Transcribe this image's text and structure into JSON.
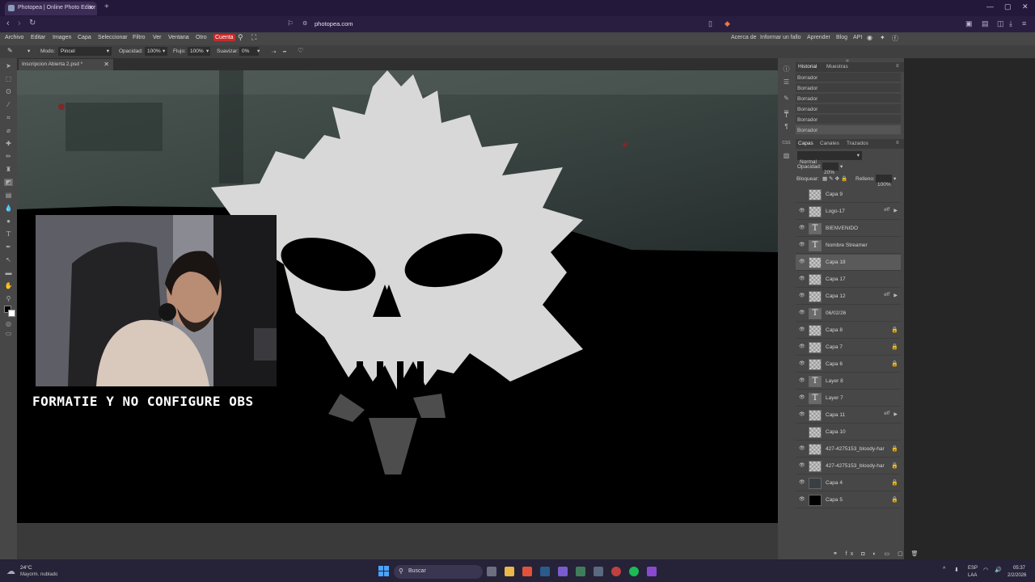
{
  "browser": {
    "tab_title": "Photopea | Online Photo Editor",
    "url": "photopea.com"
  },
  "menu": {
    "items": [
      "Archivo",
      "Editar",
      "Imagen",
      "Capa",
      "Seleccionar",
      "Filtro",
      "Ver",
      "Ventana",
      "Otro"
    ],
    "account": "Cuenta",
    "right_items": [
      "Acerca de",
      "Informar un fallo",
      "Aprender",
      "Blog",
      "API"
    ]
  },
  "options": {
    "mode_label": "Modo:",
    "mode_value": "Pincel",
    "opacity_label": "Opacidad:",
    "opacity_value": "100%",
    "flow_label": "Flujo:",
    "flow_value": "100%",
    "smooth_label": "Suavizar:",
    "smooth_value": "0%"
  },
  "document": {
    "tab_title": "Inscripcion Abierta 2.psd *"
  },
  "overlay": {
    "caption": "FORMATIE Y NO CONFIGURE OBS"
  },
  "history_panel": {
    "tabs": [
      "Historial",
      "Muestras"
    ],
    "entries": [
      "Borrador",
      "Borrador",
      "Borrador",
      "Borrador",
      "Borrador",
      "Borrador"
    ]
  },
  "layers_panel": {
    "tabs": [
      "Capas",
      "Canales",
      "Trazados"
    ],
    "blend_mode": "Normal",
    "opacity_label": "Opacidad:",
    "opacity_value": "20%",
    "lock_label": "Bloquear:",
    "fill_label": "Relleno:",
    "fill_value": "100%",
    "layers": [
      {
        "name": "Capa 9",
        "type": "check",
        "visible": false
      },
      {
        "name": "Logo-17",
        "type": "check",
        "visible": true,
        "fx": true
      },
      {
        "name": "BIENVENIDO",
        "type": "text",
        "visible": true
      },
      {
        "name": "Nombre Streamer",
        "type": "text",
        "visible": true
      },
      {
        "name": "Capa 18",
        "type": "check",
        "visible": true,
        "selected": true
      },
      {
        "name": "Capa 17",
        "type": "check",
        "visible": true
      },
      {
        "name": "Capa 12",
        "type": "check",
        "visible": true,
        "fx": true
      },
      {
        "name": "06/02/26",
        "type": "text",
        "visible": true
      },
      {
        "name": "Capa 8",
        "type": "check",
        "visible": true,
        "locked": true
      },
      {
        "name": "Capa 7",
        "type": "check",
        "visible": true,
        "locked": true
      },
      {
        "name": "Capa 6",
        "type": "check",
        "visible": true,
        "locked": true
      },
      {
        "name": "Layer 8",
        "type": "text",
        "visible": true
      },
      {
        "name": "Layer 7",
        "type": "text",
        "visible": true
      },
      {
        "name": "Capa 11",
        "type": "check",
        "visible": true,
        "fx": true
      },
      {
        "name": "Capa 10",
        "type": "check",
        "visible": false
      },
      {
        "name": "427-4275153_bloody-har",
        "type": "check",
        "visible": true,
        "locked": true
      },
      {
        "name": "427-4275153_bloody-har",
        "type": "check",
        "visible": true,
        "locked": true
      },
      {
        "name": "Capa 4",
        "type": "photo",
        "visible": true,
        "locked": true
      },
      {
        "name": "Capa 5",
        "type": "black",
        "visible": true,
        "locked": true
      }
    ]
  },
  "taskbar": {
    "temperature": "24°C",
    "weather": "Mayorm. nublado",
    "search_placeholder": "Buscar",
    "lang_top": "ESP",
    "lang_bottom": "LAA",
    "time": "05:37",
    "date": "2/2/2026"
  }
}
